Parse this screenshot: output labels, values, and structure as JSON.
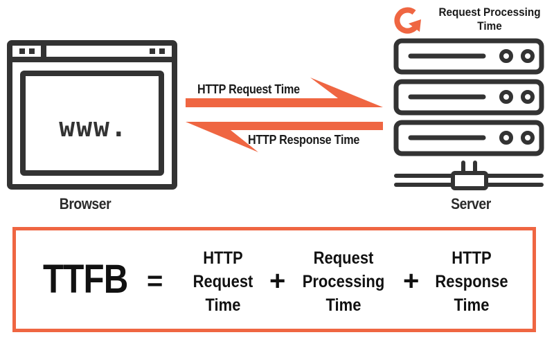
{
  "browser": {
    "label": "Browser",
    "screen_text": "www."
  },
  "server": {
    "label": "Server",
    "processing_label_line1": "Request Processing",
    "processing_label_line2": "Time"
  },
  "arrows": {
    "request_label": "HTTP Request Time",
    "response_label": "HTTP Response Time"
  },
  "formula": {
    "lhs": "TTFB",
    "equals": "=",
    "plus": "+",
    "terms": [
      {
        "line1": "HTTP",
        "line2": "Request",
        "line3": "Time"
      },
      {
        "line1": "Request",
        "line2": "Processing",
        "line3": "Time"
      },
      {
        "line1": "HTTP",
        "line2": "Response",
        "line3": "Time"
      }
    ]
  },
  "colors": {
    "accent": "#ef6642",
    "icon": "#333333",
    "text": "#1a1a1a"
  }
}
